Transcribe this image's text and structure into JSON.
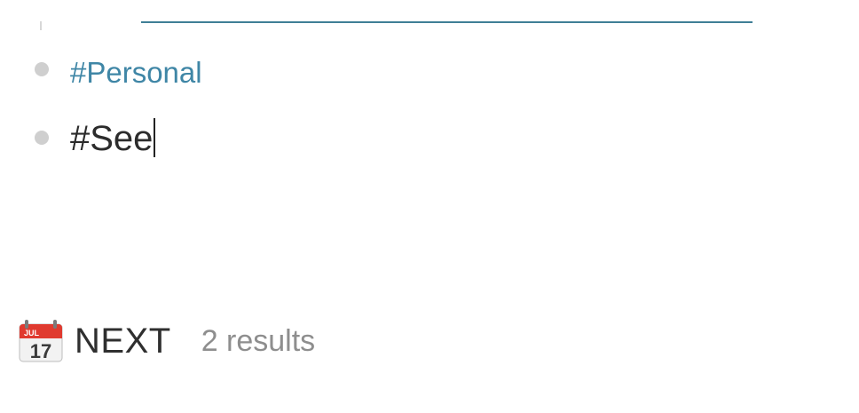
{
  "tags": [
    {
      "label": "#Personal"
    },
    {
      "label": "#See"
    }
  ],
  "query": {
    "icon": "calendar-icon",
    "icon_month": "JUL",
    "icon_day": "17",
    "title": "NEXT",
    "count_text": "2 results"
  },
  "colors": {
    "link": "#3f86a6",
    "text": "#2c2c2c",
    "muted": "#8e8e8e",
    "divider": "#3f7f96",
    "bullet": "#cfcfcf",
    "calendar_red": "#e03a2f"
  }
}
